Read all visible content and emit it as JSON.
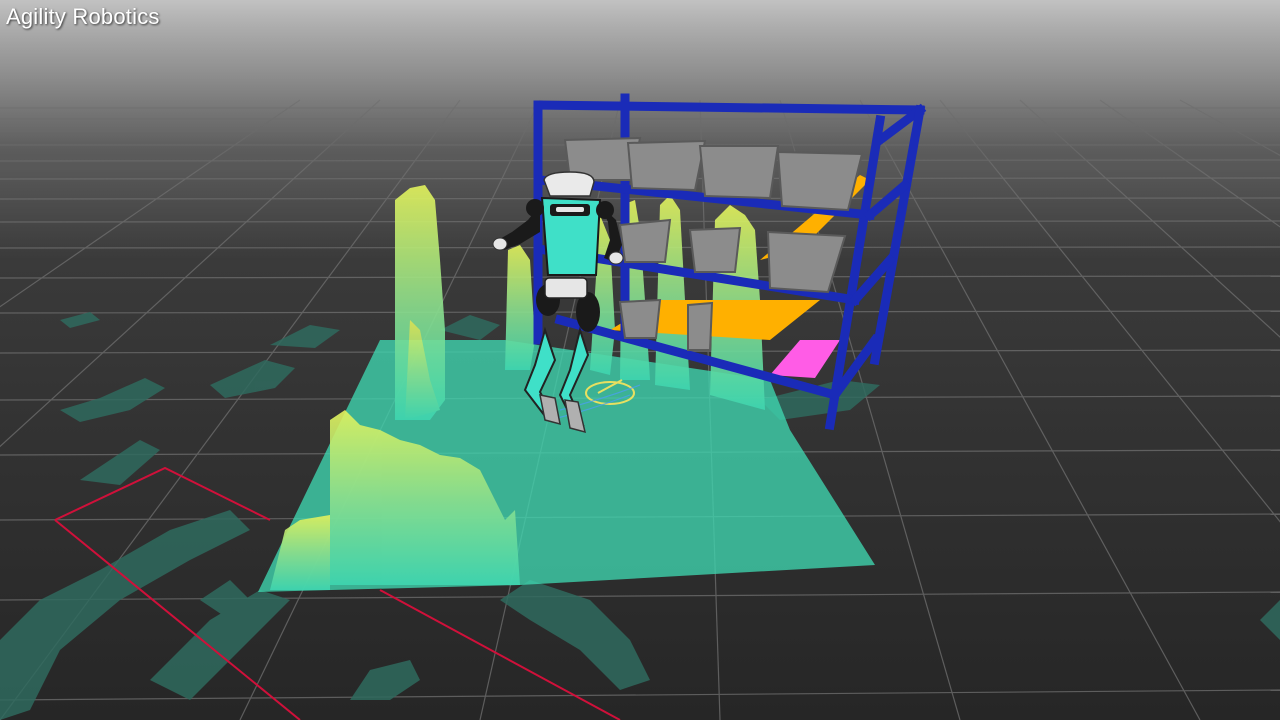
{
  "watermark": {
    "text": "Agility Robotics"
  },
  "scene": {
    "robot": "humanoid-robot",
    "shelf_bins_top_row": 4,
    "shelf_bins_middle_row": 3,
    "colors": {
      "shelf_frame": "#1a2bb8",
      "bin": "#8c8c8c",
      "heightmap_low": "#3fd6b0",
      "heightmap_high": "#d8f05a",
      "robot_torso": "#3fe0c8",
      "marker_pad_orange": "#ffb000",
      "marker_pad_pink": "#ff5ce6",
      "boundary_line": "#d0103a",
      "grid_line": "#6a6a6a",
      "floor_scan": "#2f6a5e"
    }
  }
}
